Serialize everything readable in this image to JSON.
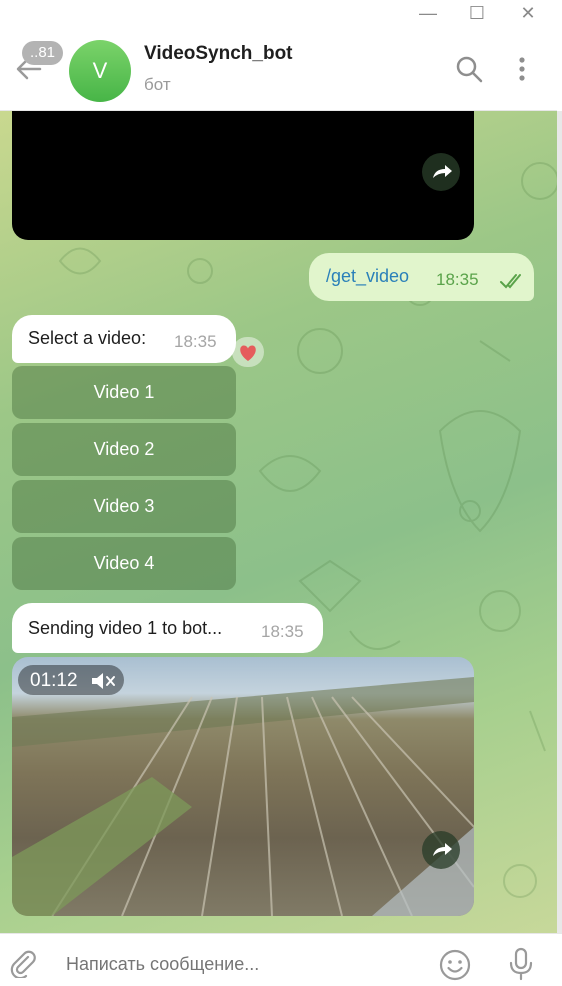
{
  "window": {
    "minimize_glyph": "—",
    "maximize_glyph": "☐",
    "close_glyph": "✕"
  },
  "header": {
    "unread_badge": "..81",
    "avatar_letter": "V",
    "title": "VideoSynch_bot",
    "subtitle": "бот",
    "icons": [
      "back-arrow-icon",
      "search-icon",
      "more-vertical-icon"
    ]
  },
  "messages": {
    "outgoing": {
      "text": "/get_video",
      "time": "18:35",
      "status_icon": "double-check-icon"
    },
    "select": {
      "text": "Select a video:",
      "time": "18:35",
      "reaction_icon": "heart-icon"
    },
    "keyboard": [
      "Video 1",
      "Video 2",
      "Video 3",
      "Video 4"
    ],
    "sending": {
      "text": "Sending video 1 to bot...",
      "time": "18:35"
    },
    "video": {
      "duration": "01:12",
      "muted_icon": "speaker-muted-icon",
      "share_icon": "share-forward-icon"
    }
  },
  "composer": {
    "placeholder": "Написать сообщение...",
    "icons": [
      "paperclip-icon",
      "emoji-icon",
      "microphone-icon"
    ]
  },
  "colors": {
    "accent_green": "#4fae4e",
    "outgoing_bubble": "#e1f5cc",
    "link_blue": "#2a80b9"
  }
}
